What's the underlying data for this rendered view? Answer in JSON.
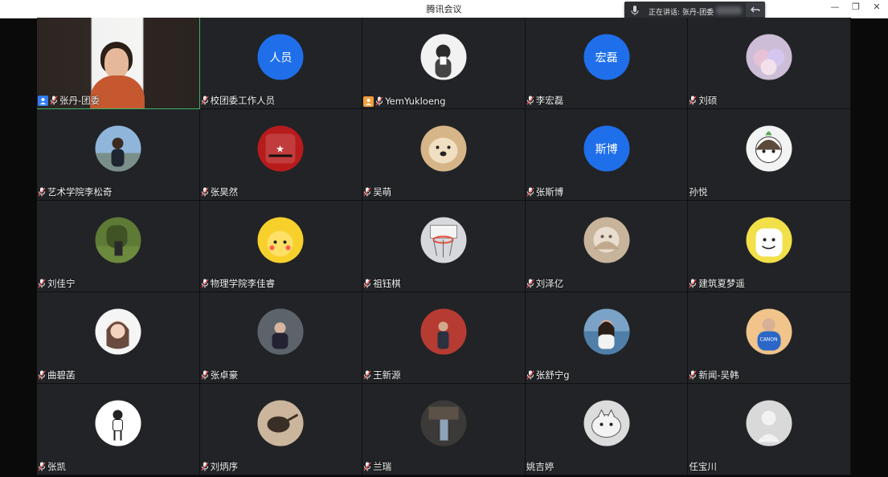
{
  "window": {
    "title": "腾讯会议",
    "speaking_text": "正在讲话: 张丹-团委",
    "min": "—",
    "restore": "❐",
    "close": "✕"
  },
  "participants": [
    {
      "name": "张丹-团委",
      "video": true,
      "host": true
    },
    {
      "name": "校团委工作人员",
      "avatar_text": "人员",
      "avatar_color": "#1f6feb"
    },
    {
      "name": "YemYukloeng",
      "cohost": true,
      "avatar_theme": "sketch"
    },
    {
      "name": "李宏磊",
      "avatar_text": "宏磊",
      "avatar_color": "#1f6feb"
    },
    {
      "name": "刘硕",
      "avatar_theme": "plush"
    },
    {
      "name": "艺术学院李松奇",
      "avatar_theme": "person-outdoor"
    },
    {
      "name": "张昊然",
      "avatar_theme": "red-poster"
    },
    {
      "name": "吴萌",
      "avatar_theme": "dog"
    },
    {
      "name": "张斯博",
      "avatar_text": "斯博",
      "avatar_color": "#1f6feb"
    },
    {
      "name": "孙悦",
      "no_mic": true,
      "avatar_theme": "cartoon-girl"
    },
    {
      "name": "刘佳宁",
      "avatar_theme": "tree-person"
    },
    {
      "name": "物理学院李佳睿",
      "avatar_theme": "pikachu"
    },
    {
      "name": "祖钰棋",
      "avatar_theme": "basketball-hoop"
    },
    {
      "name": "刘泽亿",
      "avatar_theme": "pale-art"
    },
    {
      "name": "建筑夏梦遥",
      "avatar_theme": "yellow-cartoon"
    },
    {
      "name": "曲碧菡",
      "avatar_theme": "cartoon-woman"
    },
    {
      "name": "张卓豪",
      "avatar_theme": "man-suit"
    },
    {
      "name": "王新源",
      "avatar_theme": "man-red-wall"
    },
    {
      "name": "张舒宁g",
      "avatar_theme": "woman-sea"
    },
    {
      "name": "新闻-吴韩",
      "avatar_theme": "blue-shirt"
    },
    {
      "name": "张凯",
      "avatar_theme": "line-man"
    },
    {
      "name": "刘炳序",
      "avatar_theme": "spoon"
    },
    {
      "name": "兰瑞",
      "avatar_theme": "dark-figure"
    },
    {
      "name": "姚吉婷",
      "no_mic": true,
      "avatar_theme": "cat-sketch"
    },
    {
      "name": "任宝川",
      "no_mic": true,
      "avatar_theme": "default"
    }
  ]
}
